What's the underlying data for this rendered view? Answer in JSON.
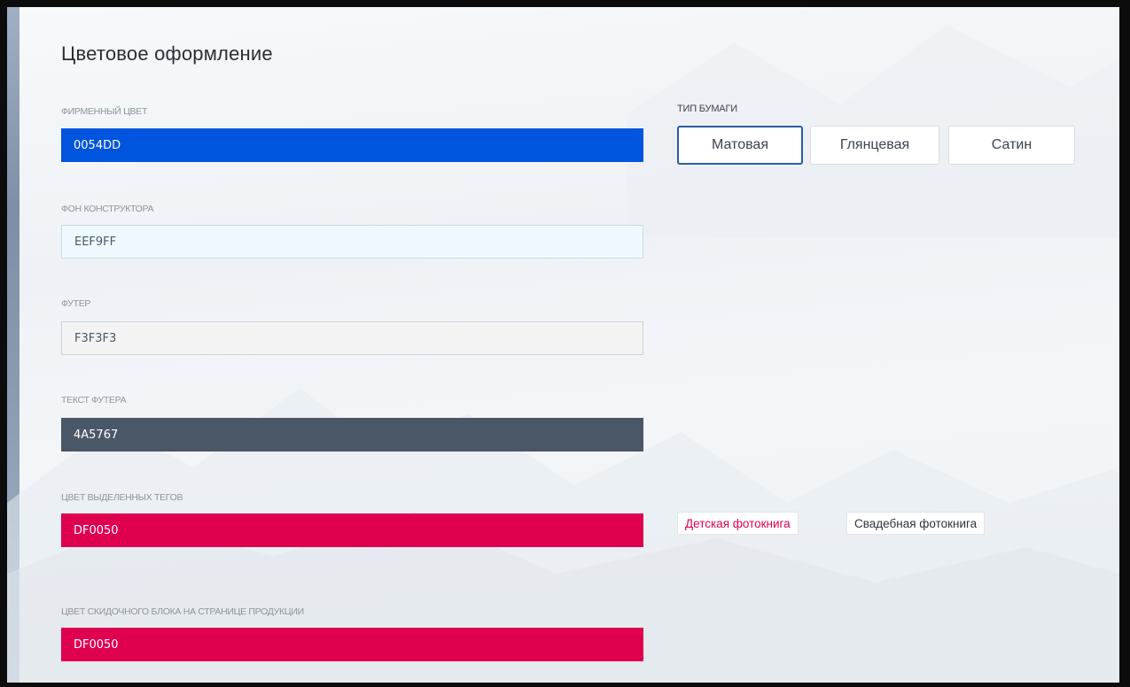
{
  "section": {
    "title": "Цветовое оформление"
  },
  "fields": [
    {
      "label": "ФИРМЕННЫЙ ЦВЕТ",
      "value": "0054DD",
      "color": "#0054DD"
    },
    {
      "label": "ФОН КОНСТРУКТОРА",
      "value": "EEF9FF",
      "color": "#EEF9FF"
    },
    {
      "label": "ФУТЕР",
      "value": "F3F3F3",
      "color": "#F3F3F3"
    },
    {
      "label": "ТЕКСТ ФУТЕРА",
      "value": "4A5767",
      "color": "#4A5767"
    },
    {
      "label": "ЦВЕТ ВЫДЕЛЕННЫХ ТЕГОВ",
      "value": "DF0050",
      "color": "#DF0050"
    },
    {
      "label": "ЦВЕТ СКИДОЧНОГО БЛОКА НА СТРАНИЦЕ ПРОДУКЦИИ",
      "value": "DF0050",
      "color": "#DF0050"
    }
  ],
  "paper": {
    "label": "ТИП БУМАГИ",
    "options": [
      "Матовая",
      "Глянцевая",
      "Сатин"
    ],
    "selected": "Матовая"
  },
  "tags": [
    {
      "label": "Детская фотокнига",
      "selected": true
    },
    {
      "label": "Свадебная фотокнига",
      "selected": false
    }
  ]
}
